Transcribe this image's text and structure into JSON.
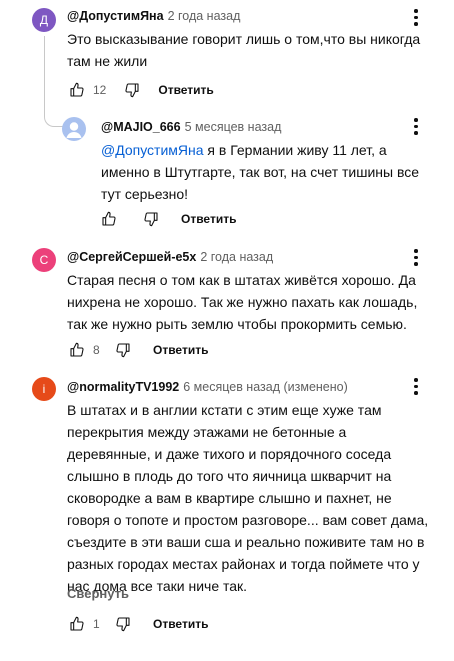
{
  "comments": [
    {
      "avatar_letter": "Д",
      "avatar_color": "#7e57c2",
      "author": "@ДопустимЯна",
      "time": "2 года назад",
      "text": "Это высказывание говорит лишь о том,что вы никогда\nтам не жили",
      "likes": "12",
      "reply_label": "Ответить"
    },
    {
      "avatar_color": "#a9c1ef",
      "author": "@MAJIO_666",
      "time": "5 месяцев назад",
      "mention": "@ДопустимЯна",
      "text": " я в Германии живу 11 лет, а\nименно в Штутгарте, так вот, на счет тишины все\nтут серьезно!",
      "likes": "",
      "reply_label": "Ответить"
    },
    {
      "avatar_letter": "С",
      "avatar_color": "#ec407a",
      "author": "@СергейСершей-е5х",
      "time": "2 года назад",
      "text": "Старая песня о том как в штатах живётся хорошо. Да\nнихрена не хорошо. Так же нужно пахать как лошадь,\nтак же нужно рыть землю чтобы прокормить семью.",
      "likes": "8",
      "reply_label": "Ответить"
    },
    {
      "avatar_letter": "i",
      "avatar_color": "#e64a19",
      "author": "@normalityTV1992",
      "time": "6 месяцев назад (изменено)",
      "text": "В штатах и в англии кстати с этим еще хуже там\nперекрытия между  этажами не бетонные а\nдеревянные, и даже тихого и порядочного соседа\nслышно в плодь до того что яичница шкварчит на\nсковородке а вам в квартире слышно и пахнет, не\nговоря о топоте и простом разговоре... вам совет дама,\nсъездите в эти ваши сша и реально поживите там но в\nразных городах местах районах и тогда поймете что у\nнас дома все таки ниче так.",
      "collapse_label": "Свернуть",
      "likes": "1",
      "reply_label": "Ответить"
    }
  ]
}
